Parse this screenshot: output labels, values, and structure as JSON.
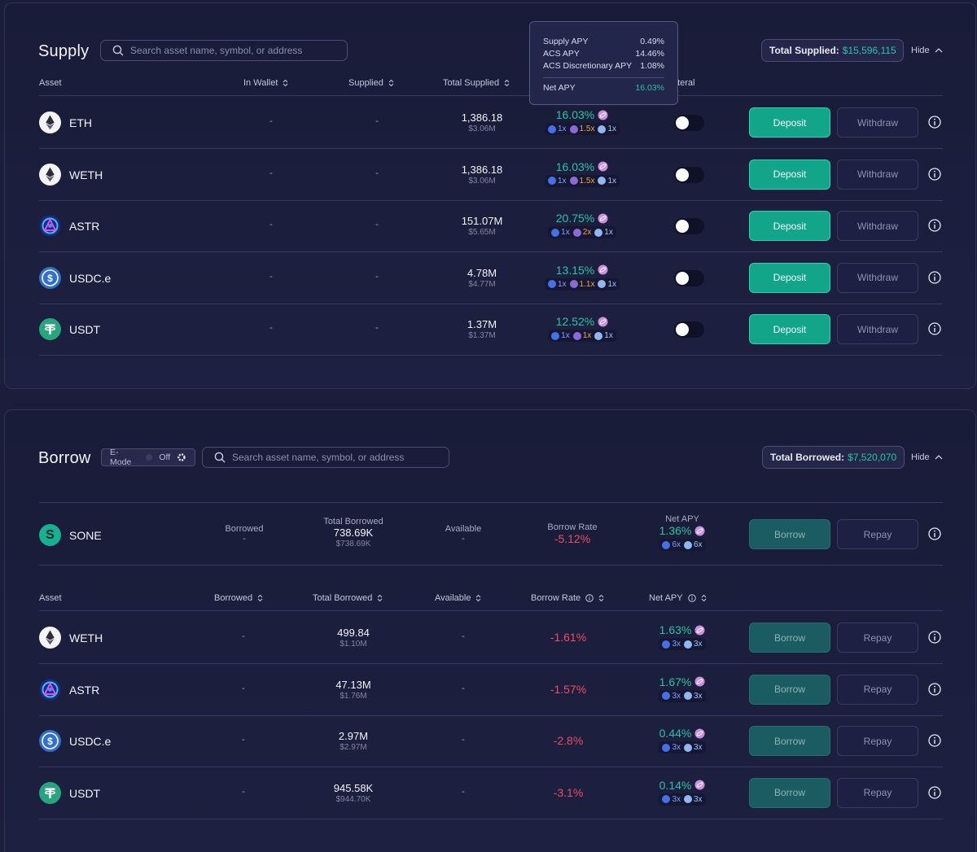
{
  "supply": {
    "title": "Supply",
    "search_placeholder": "Search asset name, symbol, or address",
    "total_label": "Total Supplied:",
    "total_value": "$15,596,115",
    "hide_label": "Hide",
    "headers": {
      "asset": "Asset",
      "in_wallet": "In Wallet",
      "supplied": "Supplied",
      "total_supplied": "Total Supplied",
      "collateral": "Collateral"
    },
    "tooltip": {
      "supply_apy_label": "Supply APY",
      "supply_apy_value": "0.49%",
      "acs_apy_label": "ACS APY",
      "acs_apy_value": "14.46%",
      "acs_disc_label": "ACS Discretionary APY",
      "acs_disc_value": "1.08%",
      "net_apy_label": "Net APY",
      "net_apy_value": "16.03%"
    },
    "rows": [
      {
        "name": "ETH",
        "in_wallet": "-",
        "supplied": "-",
        "total": "1,386.18",
        "total_usd": "$3.06M",
        "apy": "16.03%",
        "m1": "1x",
        "m2": "1.5x",
        "m3": "1x",
        "icon": "eth-icon"
      },
      {
        "name": "WETH",
        "in_wallet": "-",
        "supplied": "-",
        "total": "1,386.18",
        "total_usd": "$3.06M",
        "apy": "16.03%",
        "m1": "1x",
        "m2": "1.5x",
        "m3": "1x",
        "icon": "weth-icon"
      },
      {
        "name": "ASTR",
        "in_wallet": "-",
        "supplied": "-",
        "total": "151.07M",
        "total_usd": "$5.65M",
        "apy": "20.75%",
        "m1": "1x",
        "m2": "2x",
        "m3": "1x",
        "icon": "astr-icon"
      },
      {
        "name": "USDC.e",
        "in_wallet": "-",
        "supplied": "-",
        "total": "4.78M",
        "total_usd": "$4.77M",
        "apy": "13.15%",
        "m1": "1x",
        "m2": "1.1x",
        "m3": "1x",
        "icon": "usdc-icon"
      },
      {
        "name": "USDT",
        "in_wallet": "-",
        "supplied": "-",
        "total": "1.37M",
        "total_usd": "$1.37M",
        "apy": "12.52%",
        "m1": "1x",
        "m2": "1x",
        "m3": "1x",
        "icon": "usdt-icon"
      }
    ],
    "deposit_label": "Deposit",
    "withdraw_label": "Withdraw"
  },
  "borrow": {
    "title": "Borrow",
    "emode_label": "E-Mode",
    "emode_state": "Off",
    "search_placeholder": "Search asset name, symbol, or address",
    "total_label": "Total Borrowed:",
    "total_value": "$7,520,070",
    "hide_label": "Hide",
    "featured": {
      "name": "SONE",
      "borrowed_label": "Borrowed",
      "borrowed": "-",
      "total_label": "Total Borrowed",
      "total": "738.69K",
      "total_usd": "$738.69K",
      "available_label": "Available",
      "available": "-",
      "rate_label": "Borrow Rate",
      "rate": "-5.12%",
      "net_label": "Net APY",
      "net": "1.36%",
      "m1": "6x",
      "m2": "6x"
    },
    "headers": {
      "asset": "Asset",
      "borrowed": "Borrowed",
      "total_borrowed": "Total Borrowed",
      "available": "Available",
      "borrow_rate": "Borrow Rate",
      "net_apy": "Net APY"
    },
    "rows": [
      {
        "name": "WETH",
        "borrowed": "-",
        "total": "499.84",
        "total_usd": "$1.10M",
        "available": "-",
        "rate": "-1.61%",
        "net": "1.63%",
        "m1": "3x",
        "m2": "3x"
      },
      {
        "name": "ASTR",
        "borrowed": "-",
        "total": "47.13M",
        "total_usd": "$1.76M",
        "available": "-",
        "rate": "-1.57%",
        "net": "1.67%",
        "m1": "3x",
        "m2": "3x"
      },
      {
        "name": "USDC.e",
        "borrowed": "-",
        "total": "2.97M",
        "total_usd": "$2.97M",
        "available": "-",
        "rate": "-2.8%",
        "net": "0.44%",
        "m1": "3x",
        "m2": "3x"
      },
      {
        "name": "USDT",
        "borrowed": "-",
        "total": "945.58K",
        "total_usd": "$944.70K",
        "available": "-",
        "rate": "-3.1%",
        "net": "0.14%",
        "m1": "3x",
        "m2": "3x"
      }
    ],
    "borrow_label": "Borrow",
    "repay_label": "Repay"
  },
  "colors": {
    "accent": "#2bc3a5",
    "negative": "#ee4d63",
    "deposit": "#12a58a",
    "background": "#1b1d3a"
  }
}
